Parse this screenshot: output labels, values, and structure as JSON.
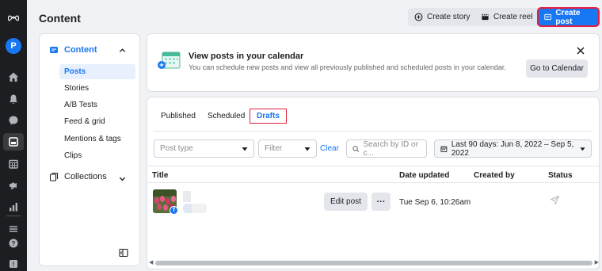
{
  "header": {
    "title": "Content",
    "buttons": {
      "create_story": "Create story",
      "create_reel": "Create reel",
      "create_post": "Create post"
    }
  },
  "rail": {
    "avatar_letter": "P",
    "icons": [
      "meta-logo-icon",
      "home-icon",
      "notifications-icon",
      "messages-icon",
      "content-icon",
      "planner-icon",
      "ads-icon",
      "insights-icon",
      "menu-icon",
      "help-icon",
      "report-icon"
    ]
  },
  "nav": {
    "section_label": "Content",
    "items": [
      "Posts",
      "Stories",
      "A/B Tests",
      "Feed & grid",
      "Mentions & tags",
      "Clips"
    ],
    "active_item": "Posts",
    "collections_label": "Collections"
  },
  "banner": {
    "title": "View posts in your calendar",
    "description": "You can schedule new posts and view all previously published and scheduled posts in your calendar.",
    "button": "Go to Calendar"
  },
  "tabs": {
    "published": "Published",
    "scheduled": "Scheduled",
    "drafts": "Drafts",
    "active": "Drafts"
  },
  "filters": {
    "post_type": "Post type",
    "filter": "Filter",
    "clear": "Clear",
    "search_placeholder": "Search by ID or c...",
    "date_range": "Last 90 days: Jun 8, 2022 – Sep 5, 2022"
  },
  "table": {
    "columns": {
      "title": "Title",
      "date_updated": "Date updated",
      "created_by": "Created by",
      "status": "Status"
    },
    "rows": [
      {
        "edit_label": "Edit post",
        "more_label": "···",
        "date_updated": "Tue Sep 6, 10:26am",
        "platform_badge": "f"
      }
    ]
  },
  "colors": {
    "accent": "#1877f2",
    "highlight_border": "#e41e3f",
    "rail_bg": "#1c1e21",
    "page_bg": "#f0f2f5"
  }
}
